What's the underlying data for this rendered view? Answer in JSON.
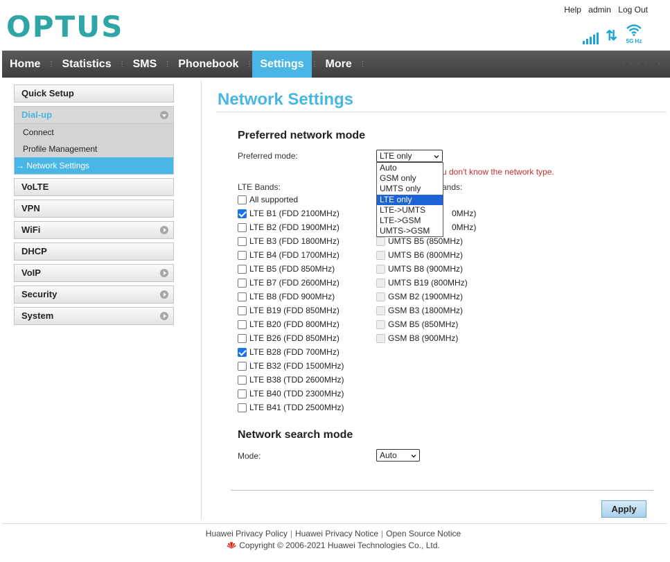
{
  "brand": {
    "logo": "OPTUS",
    "accent": "#49b6e6",
    "logo_color": "#2fa5a5"
  },
  "top_links": {
    "help": "Help",
    "user": "admin",
    "logout": "Log Out"
  },
  "status": {
    "signal_icon": "signal-bars-icon",
    "data_icon": "up-down-arrows-icon",
    "wifi_icon": "wifi-icon",
    "wifi_band": "5G Hz"
  },
  "nav": {
    "items": [
      {
        "label": "Home"
      },
      {
        "label": "Statistics"
      },
      {
        "label": "SMS"
      },
      {
        "label": "Phonebook"
      },
      {
        "label": "Settings",
        "active": true
      },
      {
        "label": "More"
      }
    ]
  },
  "sidebar": {
    "quick_setup": "Quick Setup",
    "dialup": "Dial-up",
    "dialup_sub": {
      "connect": "Connect",
      "profile": "Profile Management",
      "network": "→ Network Settings"
    },
    "volte": "VoLTE",
    "vpn": "VPN",
    "wifi": "WiFi",
    "dhcp": "DHCP",
    "voip": "VoIP",
    "security": "Security",
    "system": "System"
  },
  "main": {
    "title": "Network Settings",
    "preferred_section": "Preferred network mode",
    "preferred_label": "Preferred mode:",
    "preferred_value": "LTE only",
    "hint": "u don't know the network type.",
    "lte_bands_label": "LTE Bands:",
    "other_bands_label_visible": "ands:",
    "preferred_options": [
      "Auto",
      "GSM only",
      "UMTS only",
      "LTE only",
      "LTE->UMTS",
      "LTE->GSM",
      "UMTS->GSM"
    ],
    "lte_bands": [
      {
        "label": "All supported",
        "checked": false
      },
      {
        "label": "LTE B1 (FDD 2100MHz)",
        "checked": true
      },
      {
        "label": "LTE B2 (FDD 1900MHz)",
        "checked": false
      },
      {
        "label": "LTE B3 (FDD 1800MHz)",
        "checked": false
      },
      {
        "label": "LTE B4 (FDD 1700MHz)",
        "checked": false
      },
      {
        "label": "LTE B5 (FDD 850MHz)",
        "checked": false
      },
      {
        "label": "LTE B7 (FDD 2600MHz)",
        "checked": false
      },
      {
        "label": "LTE B8 (FDD 900MHz)",
        "checked": false
      },
      {
        "label": "LTE B19 (FDD 850MHz)",
        "checked": false
      },
      {
        "label": "LTE B20 (FDD 800MHz)",
        "checked": false
      },
      {
        "label": "LTE B26 (FDD 850MHz)",
        "checked": false
      },
      {
        "label": "LTE B28 (FDD 700MHz)",
        "checked": true
      },
      {
        "label": "LTE B32 (FDD 1500MHz)",
        "checked": false
      },
      {
        "label": "LTE B38 (TDD 2600MHz)",
        "checked": false
      },
      {
        "label": "LTE B40 (TDD 2300MHz)",
        "checked": false
      },
      {
        "label": "LTE B41 (TDD 2500MHz)",
        "checked": false
      }
    ],
    "other_bands_partial": [
      "0MHz)",
      "0MHz)"
    ],
    "other_bands": [
      "UMTS B5 (850MHz)",
      "UMTS B6 (800MHz)",
      "UMTS B8 (900MHz)",
      "UMTS B19 (800MHz)",
      "GSM B2 (1900MHz)",
      "GSM B3 (1800MHz)",
      "GSM B5 (850MHz)",
      "GSM B8 (900MHz)"
    ],
    "search_section": "Network search mode",
    "search_label": "Mode:",
    "search_value": "Auto",
    "apply": "Apply"
  },
  "footer": {
    "links": [
      "Huawei Privacy Policy",
      "Huawei Privacy Notice",
      "Open Source Notice"
    ],
    "copyright": "Copyright © 2006-2021 Huawei Technologies Co., Ltd."
  }
}
